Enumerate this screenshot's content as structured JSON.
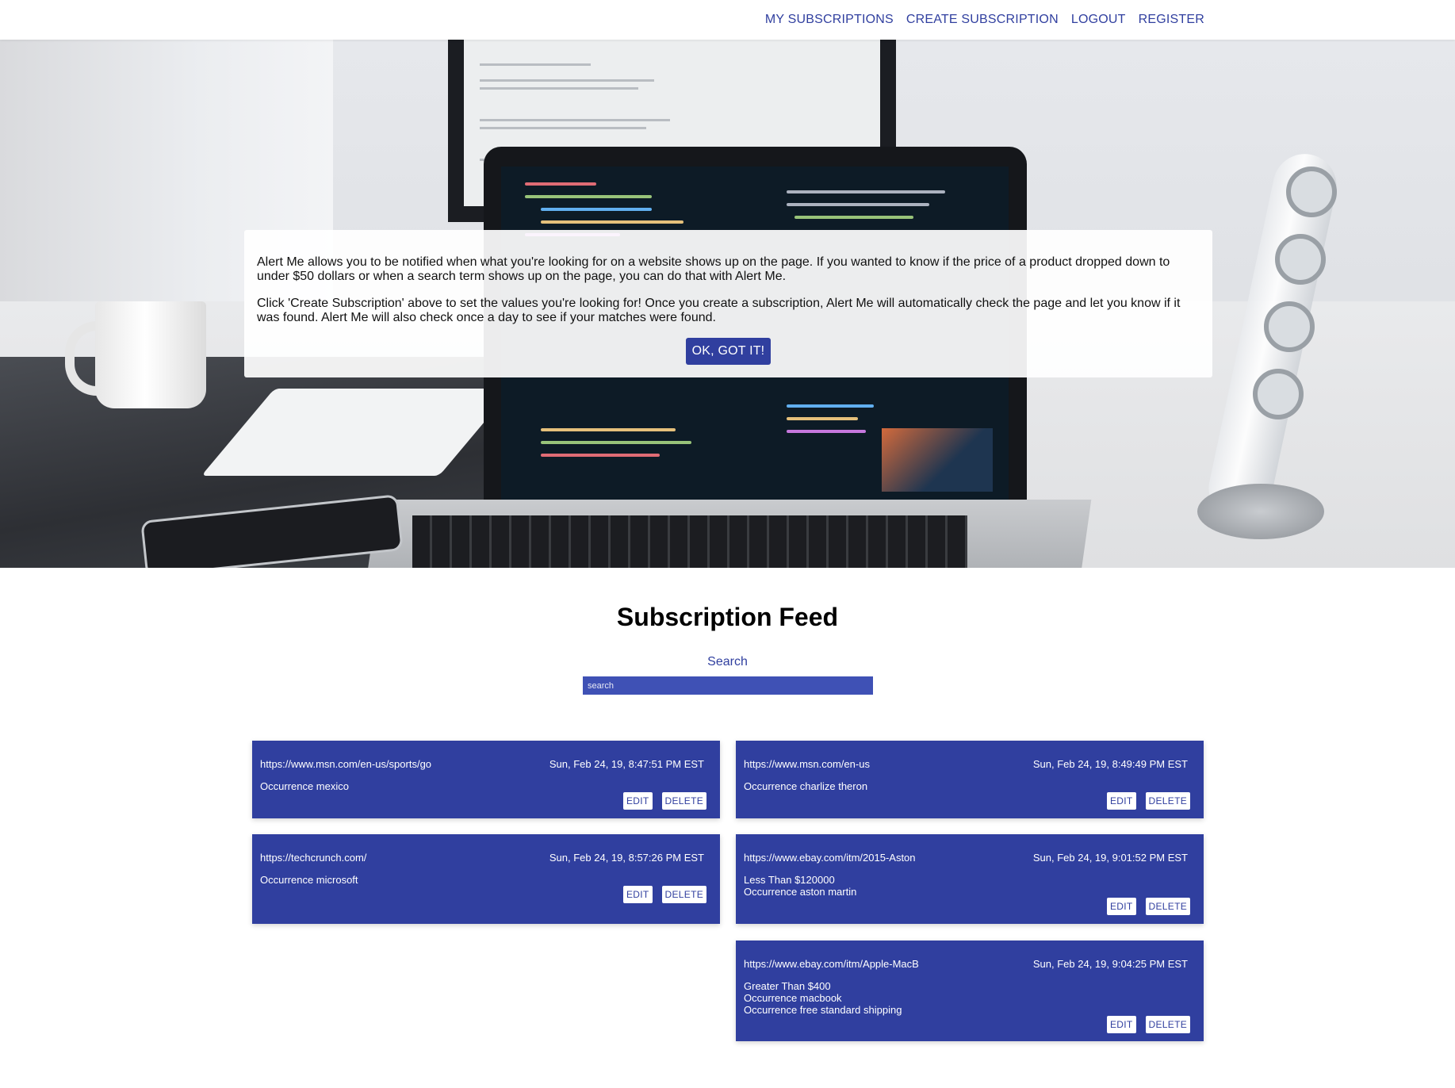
{
  "nav": {
    "links": [
      "MY SUBSCRIPTIONS",
      "CREATE SUBSCRIPTION",
      "LOGOUT",
      "REGISTER"
    ]
  },
  "intro": {
    "paragraph_1": "Alert Me allows you to be notified when what you're looking for on a website shows up on the page. If you wanted to know if the price of a product dropped down to under $50 dollars or when a search term shows up on the page, you can do that with Alert Me.",
    "paragraph_2": "Click 'Create Subscription' above to set the values you're looking for! Once you create a subscription, Alert Me will automatically check the page and let you know if it was found. Alert Me will also check once a day to see if your matches were found.",
    "button_label": "OK, GOT IT!"
  },
  "feed": {
    "title": "Subscription Feed",
    "search_label": "Search",
    "search_placeholder": "search",
    "edit_label": "EDIT",
    "delete_label": "DELETE",
    "cards": [
      {
        "url": "https://www.msn.com/en-us/sports/go",
        "date": "Sun, Feb 24, 19, 8:47:51 PM EST",
        "lines": [
          "Occurrence mexico"
        ]
      },
      {
        "url": "https://www.msn.com/en-us",
        "date": "Sun, Feb 24, 19, 8:49:49 PM EST",
        "lines": [
          "Occurrence charlize theron"
        ]
      },
      {
        "url": "https://techcrunch.com/",
        "date": "Sun, Feb 24, 19, 8:57:26 PM EST",
        "lines": [
          "Occurrence microsoft"
        ]
      },
      {
        "url": "https://www.ebay.com/itm/2015-Aston",
        "date": "Sun, Feb 24, 19, 9:01:52 PM EST",
        "lines": [
          "Less Than $120000",
          "Occurrence aston martin"
        ]
      },
      {
        "url": "https://www.ebay.com/itm/Apple-MacB",
        "date": "Sun, Feb 24, 19, 9:04:25 PM EST",
        "lines": [
          "Greater Than $400",
          "Occurrence macbook",
          "Occurrence free standard shipping"
        ]
      }
    ]
  },
  "colors": {
    "primary": "#303f9f",
    "search_bg": "#3f51b5"
  }
}
